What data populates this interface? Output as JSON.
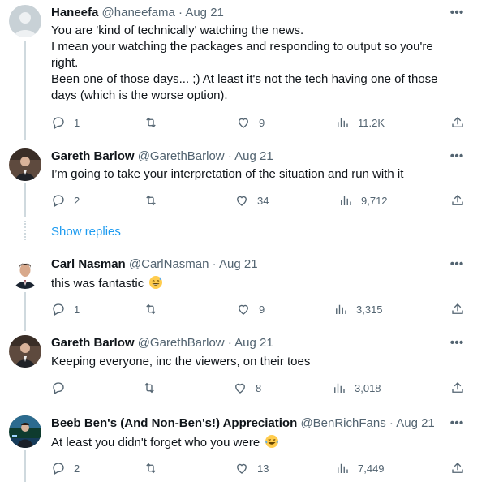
{
  "more_icon_glyph": "•••",
  "show_replies_label": "Show replies",
  "tweets": [
    {
      "name": "Haneefa",
      "handle": "@haneefama",
      "date": "· Aug 21",
      "lines": [
        "You are 'kind of technically' watching the news.",
        "I mean your watching the packages and responding to output so you're",
        "right.",
        "Been one of those days... ;) At least it's not the tech having one of those",
        "days (which is the worse option)."
      ],
      "replies": "1",
      "retweets": "",
      "likes": "9",
      "views": "11.2K"
    },
    {
      "name": "Gareth Barlow",
      "handle": "@GarethBarlow",
      "date": "· Aug 21",
      "lines": [
        "I’m going to take your interpretation of the situation and run with it"
      ],
      "replies": "2",
      "retweets": "",
      "likes": "34",
      "views": "9,712"
    },
    {
      "name": "Carl Nasman",
      "handle": "@CarlNasman",
      "date": "· Aug 21",
      "lines": [
        "this was fantastic"
      ],
      "emoji": "sweat-smile",
      "replies": "1",
      "retweets": "",
      "likes": "9",
      "views": "3,315"
    },
    {
      "name": "Gareth Barlow",
      "handle": "@GarethBarlow",
      "date": "· Aug 21",
      "lines": [
        "Keeping everyone, inc the viewers, on their toes"
      ],
      "replies": "",
      "retweets": "",
      "likes": "8",
      "views": "3,018"
    },
    {
      "name": "Beeb Ben's (And Non-Ben's!) Appreciation",
      "handle": "@BenRichFans",
      "date": "· Aug 21",
      "lines": [
        "At least you didn't forget who you were"
      ],
      "emoji": "tears-of-joy",
      "replies": "2",
      "retweets": "",
      "likes": "13",
      "views": "7,449"
    }
  ],
  "colors": {
    "link": "#1d9bf0",
    "muted": "#536471",
    "text": "#0f1419",
    "line": "#cfd9de"
  }
}
